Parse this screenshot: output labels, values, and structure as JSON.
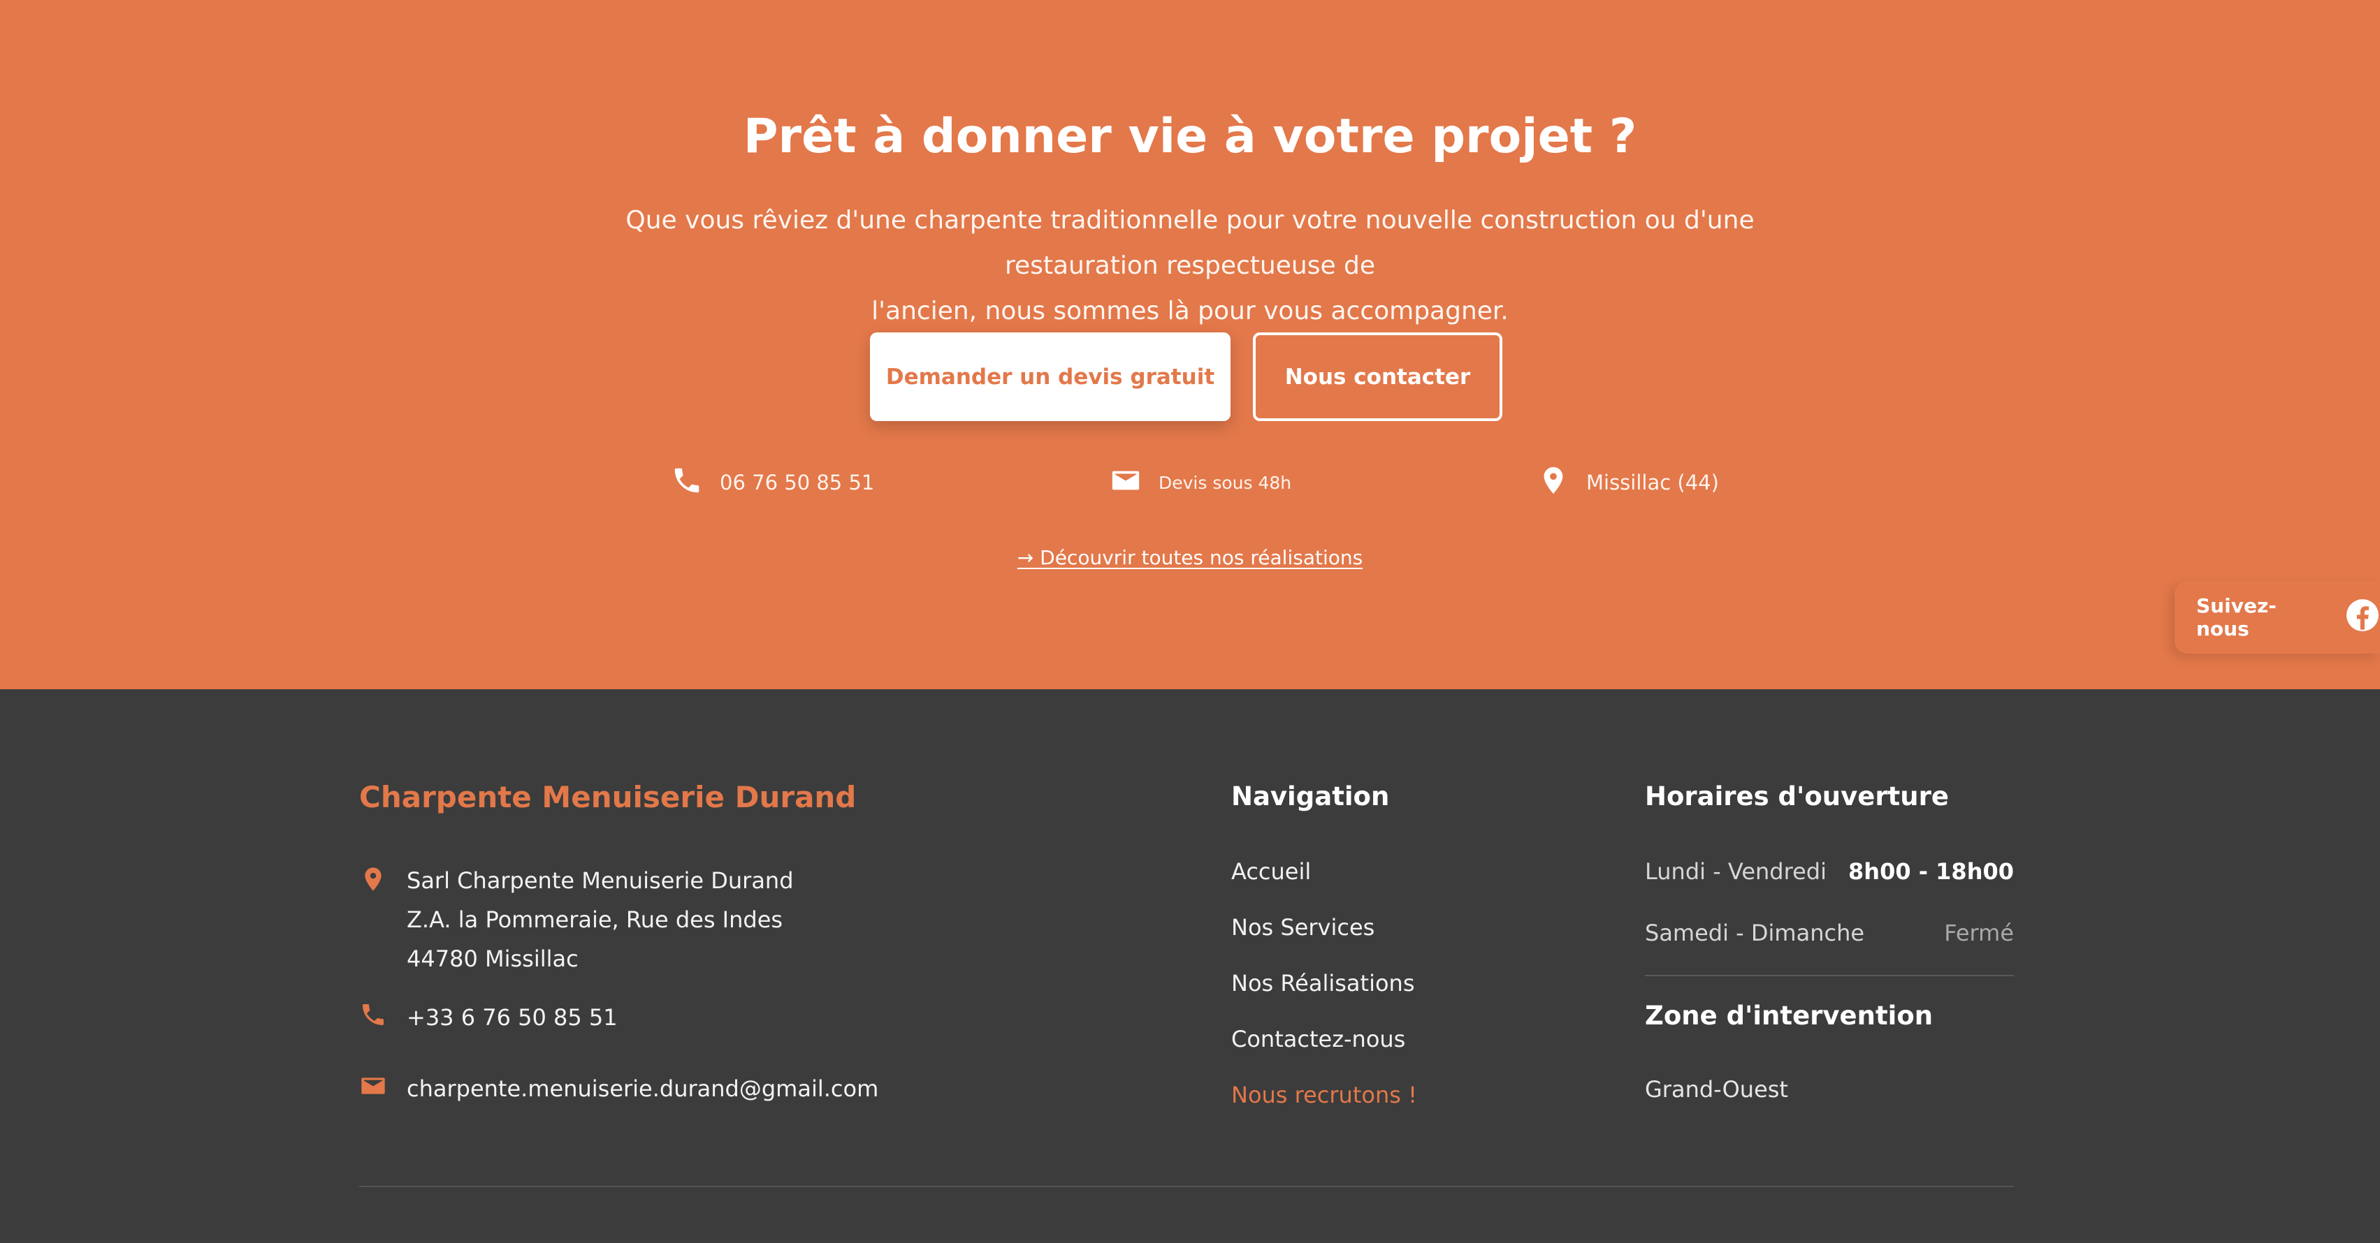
{
  "colors": {
    "accent": "#e3784a",
    "footer_bg": "#3c3c3c",
    "white": "#ffffff"
  },
  "cta": {
    "title": "Prêt à donner vie à votre projet ?",
    "text_line1": "Que vous rêviez d'une charpente traditionnelle pour votre nouvelle construction ou d'une restauration respectueuse de",
    "text_line2": "l'ancien, nous sommes là pour vous accompagner.",
    "primary_button": "Demander un devis gratuit",
    "secondary_button": "Nous contacter",
    "info": {
      "phone": {
        "icon": "phone-icon",
        "text": "06 76 50 85 51"
      },
      "mail": {
        "icon": "mail-icon",
        "text": "Devis sous 48h"
      },
      "location": {
        "icon": "location-pin-icon",
        "text": "Missillac (44)"
      }
    },
    "discover_link": "→ Découvrir toutes nos réalisations"
  },
  "follow": {
    "label": "Suivez-nous",
    "icon": "facebook-icon"
  },
  "footer": {
    "brand": "Charpente Menuiserie Durand",
    "address": {
      "icon": "location-pin-icon",
      "line1": "Sarl Charpente Menuiserie Durand",
      "line2": "Z.A. la Pommeraie, Rue des Indes",
      "line3": "44780 Missillac"
    },
    "phone": {
      "icon": "phone-icon",
      "text": "+33 6 76 50 85 51"
    },
    "email": {
      "icon": "mail-icon",
      "text": "charpente.menuiserie.durand@gmail.com"
    },
    "navigation": {
      "title": "Navigation",
      "items": [
        "Accueil",
        "Nos Services",
        "Nos Réalisations",
        "Contactez-nous",
        "Nous recrutons !"
      ]
    },
    "hours": {
      "title": "Horaires d'ouverture",
      "rows": [
        {
          "day": "Lundi - Vendredi",
          "time": "8h00 - 18h00"
        },
        {
          "day": "Samedi - Dimanche",
          "time": "Fermé"
        }
      ]
    },
    "zone": {
      "title": "Zone d'intervention",
      "value": "Grand-Ouest"
    }
  }
}
